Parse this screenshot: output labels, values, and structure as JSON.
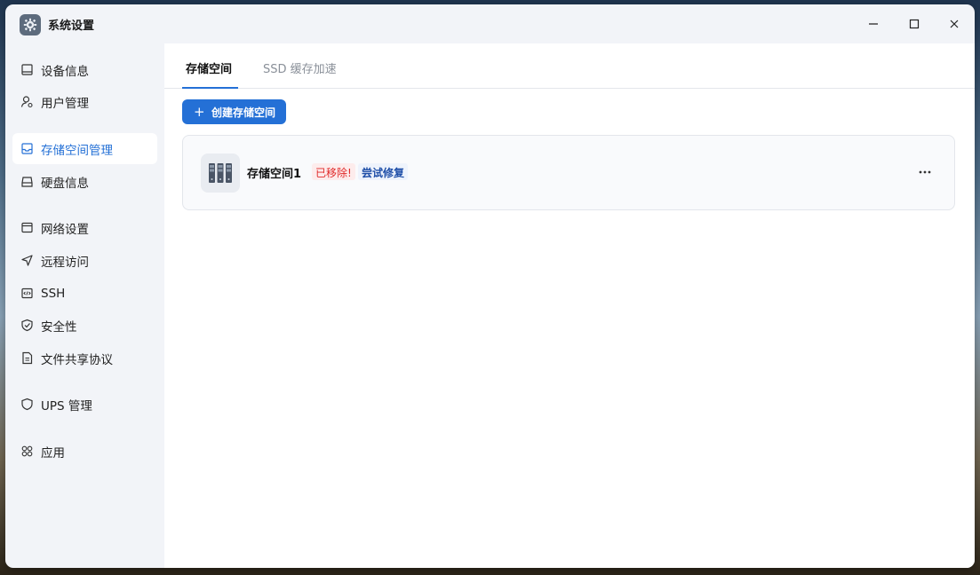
{
  "window": {
    "title": "系统设置",
    "app_icon": "gear-icon",
    "controls": [
      "minimize-icon",
      "maximize-icon",
      "close-icon"
    ]
  },
  "sidebar": {
    "items": [
      {
        "label": "设备信息",
        "icon": "monitor-icon",
        "active": false
      },
      {
        "label": "用户管理",
        "icon": "user-gear-icon",
        "active": false
      },
      {
        "label": "存储空间管理",
        "icon": "storage-icon",
        "active": true
      },
      {
        "label": "硬盘信息",
        "icon": "hard-disk-icon",
        "active": false
      },
      {
        "label": "网络设置",
        "icon": "network-icon",
        "active": false
      },
      {
        "label": "远程访问",
        "icon": "send-icon",
        "active": false
      },
      {
        "label": "SSH",
        "icon": "terminal-icon",
        "active": false
      },
      {
        "label": "安全性",
        "icon": "shield-check-icon",
        "active": false
      },
      {
        "label": "文件共享协议",
        "icon": "document-icon",
        "active": false
      },
      {
        "label": "UPS 管理",
        "icon": "shield-icon",
        "active": false
      },
      {
        "label": "应用",
        "icon": "apps-icon",
        "active": false
      }
    ]
  },
  "main": {
    "tabs": [
      {
        "label": "存储空间",
        "active": true
      },
      {
        "label": "SSD 缓存加速",
        "active": false
      }
    ],
    "create_button": {
      "label": "创建存储空间",
      "icon": "plus-icon"
    },
    "storage_pools": [
      {
        "name": "存储空间1",
        "status": "已移除!",
        "action": "尝试修复",
        "icon": "storage-rack-icon",
        "menu_icon": "more-icon"
      }
    ]
  },
  "colors": {
    "accent": "#2470d6",
    "error": "#e02a2a",
    "sidebar_bg": "#f2f4f8",
    "content_bg": "#ffffff"
  }
}
